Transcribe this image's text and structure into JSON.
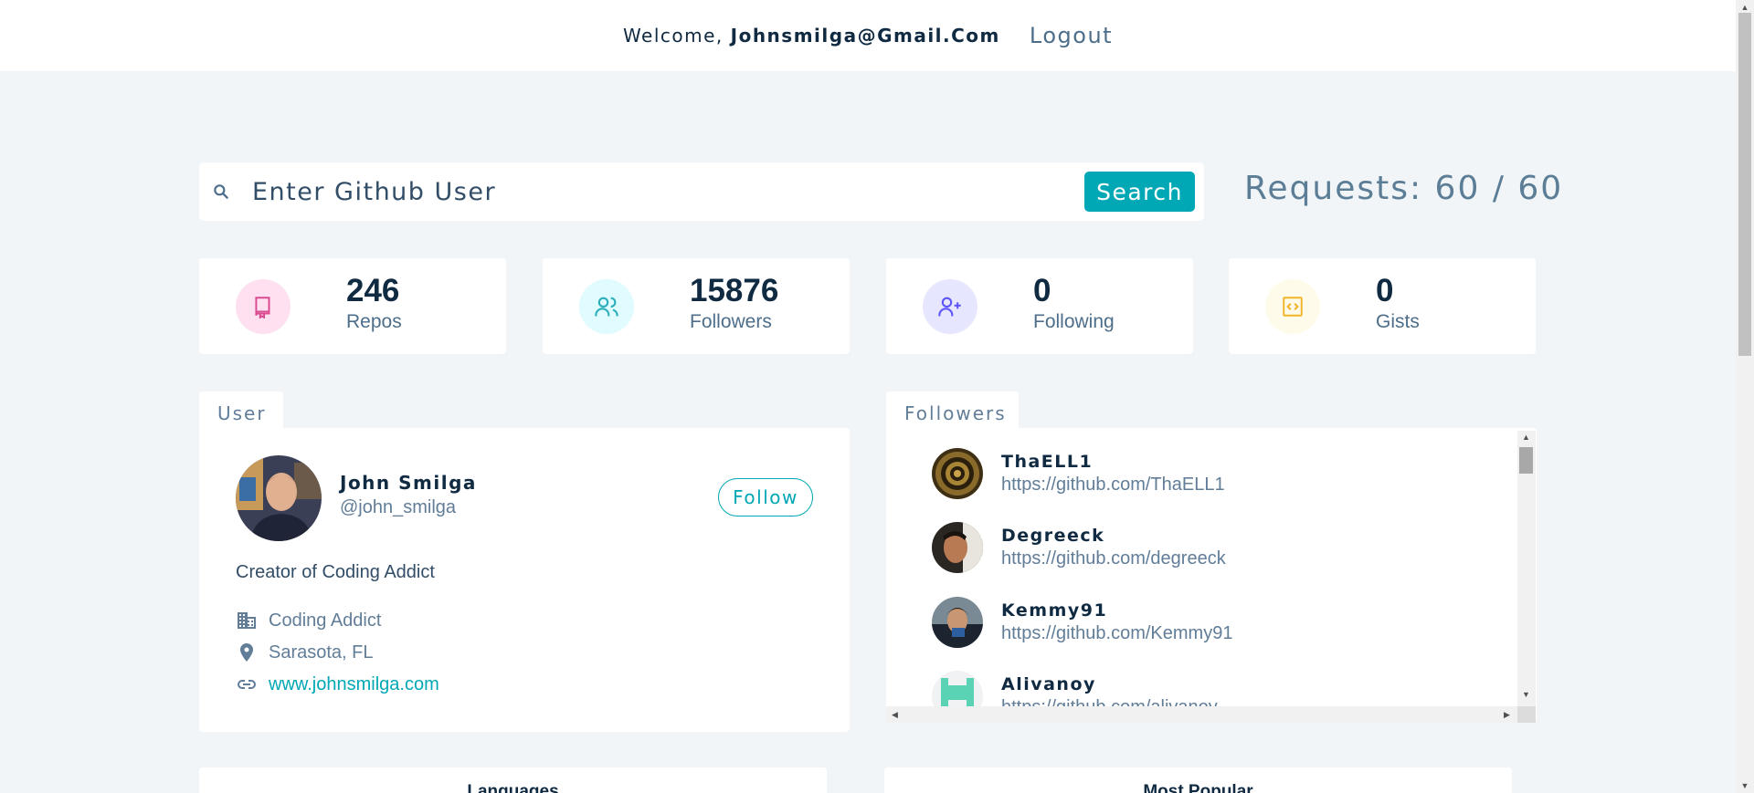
{
  "nav": {
    "welcome_prefix": "Welcome, ",
    "user_email": "Johnsmilga@Gmail.Com",
    "logout_label": "Logout"
  },
  "search": {
    "placeholder": "Enter Github User",
    "button_label": "Search",
    "requests_text": "Requests: 60 / 60"
  },
  "stats": [
    {
      "value": "246",
      "label": "Repos",
      "icon": "book-icon",
      "color": "#da4a91",
      "bg": "#ffe0f0"
    },
    {
      "value": "15876",
      "label": "Followers",
      "icon": "users-icon",
      "color": "#2caeba",
      "bg": "#e0fcff"
    },
    {
      "value": "0",
      "label": "Following",
      "icon": "user-plus-icon",
      "color": "#5d55fa",
      "bg": "#e6e6ff"
    },
    {
      "value": "0",
      "label": "Gists",
      "icon": "code-icon",
      "color": "#f0b429",
      "bg": "#fffbea"
    }
  ],
  "user": {
    "tab_label": "User",
    "name": "John Smilga",
    "login": "@john_smilga",
    "follow_label": "Follow",
    "bio": "Creator of Coding Addict",
    "company": "Coding Addict",
    "location": "Sarasota, FL",
    "blog": "www.johnsmilga.com"
  },
  "followers": {
    "tab_label": "Followers",
    "items": [
      {
        "name": "ThaELL1",
        "url": "https://github.com/ThaELL1"
      },
      {
        "name": "Degreeck",
        "url": "https://github.com/degreeck"
      },
      {
        "name": "Kemmy91",
        "url": "https://github.com/Kemmy91"
      },
      {
        "name": "Alivanoy",
        "url": "https://github.com/alivanoy"
      }
    ]
  },
  "bottom": {
    "languages_title": "Languages",
    "popular_title": "Most Popular"
  }
}
